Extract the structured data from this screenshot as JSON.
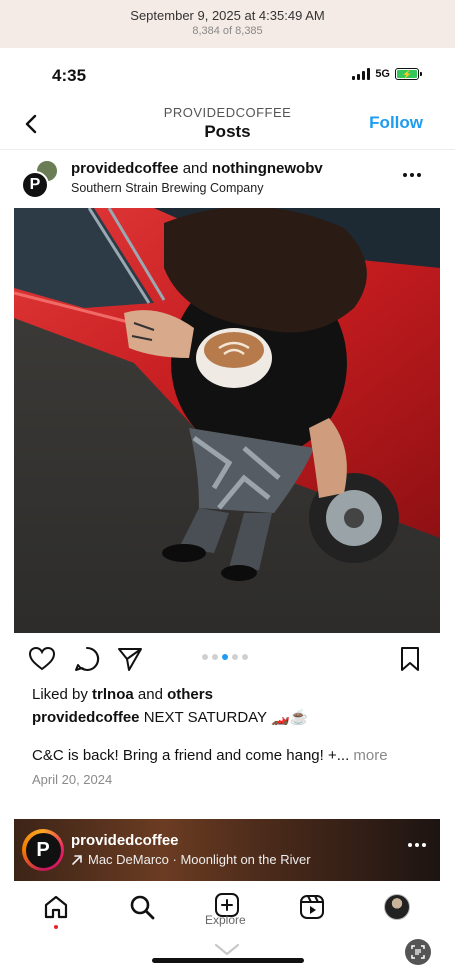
{
  "photos_app": {
    "date": "September 9, 2025 at 4:35:49 AM",
    "count": "8,384 of 8,385"
  },
  "status_bar": {
    "time": "4:35",
    "network": "5G",
    "battery_charging": true
  },
  "nav": {
    "subtitle": "PROVIDEDCOFFEE",
    "title": "Posts",
    "follow_label": "Follow",
    "accent_color": "#1f9cf0"
  },
  "post": {
    "author": "providedcoffee",
    "connector": "and",
    "collaborator": "nothingnewobv",
    "location": "Southern Strain Brewing Company",
    "carousel_count": 5,
    "carousel_active": 3,
    "liked_prefix": "Liked by",
    "liked_user": "trlnoa",
    "liked_and": "and",
    "liked_others": "others",
    "caption_user": "providedcoffee",
    "caption_text": "NEXT SATURDAY 🏎️☕",
    "caption_line2": "C&C is back! Bring a friend and come hang! +...",
    "more_label": "more",
    "date": "April 20, 2024"
  },
  "music_bar": {
    "user": "providedcoffee",
    "track": "Mac DeMarco · Moonlight on the River"
  },
  "tab_bar": {
    "items": [
      "home-icon",
      "search-icon",
      "create-icon",
      "reels-icon",
      "profile-avatar"
    ],
    "tooltip": "Explore"
  }
}
